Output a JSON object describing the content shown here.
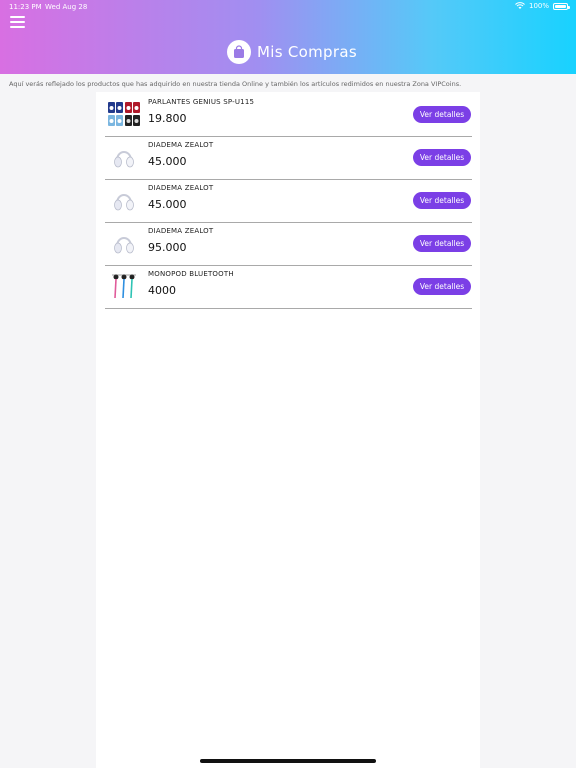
{
  "status_bar": {
    "time": "11:23 PM",
    "date": "Wed Aug 28",
    "battery": "100%"
  },
  "header": {
    "title": "Mis Compras"
  },
  "intro_text": "Aquí verás reflejado los productos que has adquirido en nuestra tienda Online y también los artículos redimidos en nuestra Zona VIPCoins.",
  "products": [
    {
      "name": "PARLANTES GENIUS SP-U115",
      "price": "19.800",
      "button": "Ver detalles",
      "icon": "speakers-icon"
    },
    {
      "name": "DIADEMA ZEALOT",
      "price": "45.000",
      "button": "Ver detalles",
      "icon": "headphones-icon"
    },
    {
      "name": "DIADEMA ZEALOT",
      "price": "45.000",
      "button": "Ver detalles",
      "icon": "headphones-icon"
    },
    {
      "name": "DIADEMA ZEALOT",
      "price": "95.000",
      "button": "Ver detalles",
      "icon": "headphones-icon"
    },
    {
      "name": "MONOPOD BLUETOOTH",
      "price": "4000",
      "button": "Ver detalles",
      "icon": "monopod-icon"
    }
  ],
  "colors": {
    "accent": "#7b3fe6",
    "gradient_start": "#d86fe2",
    "gradient_end": "#18d2ff"
  }
}
